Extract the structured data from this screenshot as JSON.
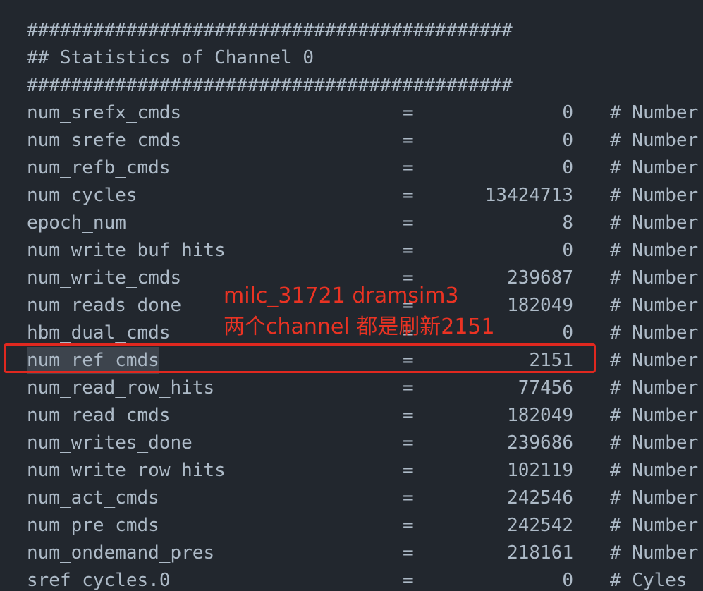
{
  "header": {
    "rule_top": "############################################",
    "title": "## Statistics of Channel 0",
    "rule_bottom": "############################################"
  },
  "stats": [
    {
      "name": "num_srefx_cmds",
      "eq": "=",
      "value": "0",
      "comment": "# Number"
    },
    {
      "name": "num_srefe_cmds",
      "eq": "=",
      "value": "0",
      "comment": "# Number"
    },
    {
      "name": "num_refb_cmds",
      "eq": "=",
      "value": "0",
      "comment": "# Number"
    },
    {
      "name": "num_cycles",
      "eq": "=",
      "value": "13424713",
      "comment": "# Number"
    },
    {
      "name": "epoch_num",
      "eq": "=",
      "value": "8",
      "comment": "# Number"
    },
    {
      "name": "num_write_buf_hits",
      "eq": "=",
      "value": "0",
      "comment": "# Number"
    },
    {
      "name": "num_write_cmds",
      "eq": "=",
      "value": "239687",
      "comment": "# Number"
    },
    {
      "name": "num_reads_done",
      "eq": "=",
      "value": "182049",
      "comment": "# Number"
    },
    {
      "name": "hbm_dual_cmds",
      "eq": "=",
      "value": "0",
      "comment": "# Number"
    },
    {
      "name": "num_ref_cmds",
      "eq": "=",
      "value": "2151",
      "comment": "# Number"
    },
    {
      "name": "num_read_row_hits",
      "eq": "=",
      "value": "77456",
      "comment": "# Number"
    },
    {
      "name": "num_read_cmds",
      "eq": "=",
      "value": "182049",
      "comment": "# Number"
    },
    {
      "name": "num_writes_done",
      "eq": "=",
      "value": "239686",
      "comment": "# Number"
    },
    {
      "name": "num_write_row_hits",
      "eq": "=",
      "value": "102119",
      "comment": "# Number"
    },
    {
      "name": "num_act_cmds",
      "eq": "=",
      "value": "242546",
      "comment": "# Number"
    },
    {
      "name": "num_pre_cmds",
      "eq": "=",
      "value": "242542",
      "comment": "# Number"
    },
    {
      "name": "num_ondemand_pres",
      "eq": "=",
      "value": "218161",
      "comment": "# Number"
    },
    {
      "name": "sref_cycles.0",
      "eq": "=",
      "value": "0",
      "comment": "# Cyles"
    }
  ],
  "annotation": {
    "line1": "milc_31721 dramsim3",
    "line2": "两个channel 都是刷新2151",
    "color": "#ea3323"
  },
  "colors": {
    "background": "#22272e",
    "text": "#adbac7",
    "highlight_box": "#e0281f",
    "selection": "#3d444d"
  }
}
